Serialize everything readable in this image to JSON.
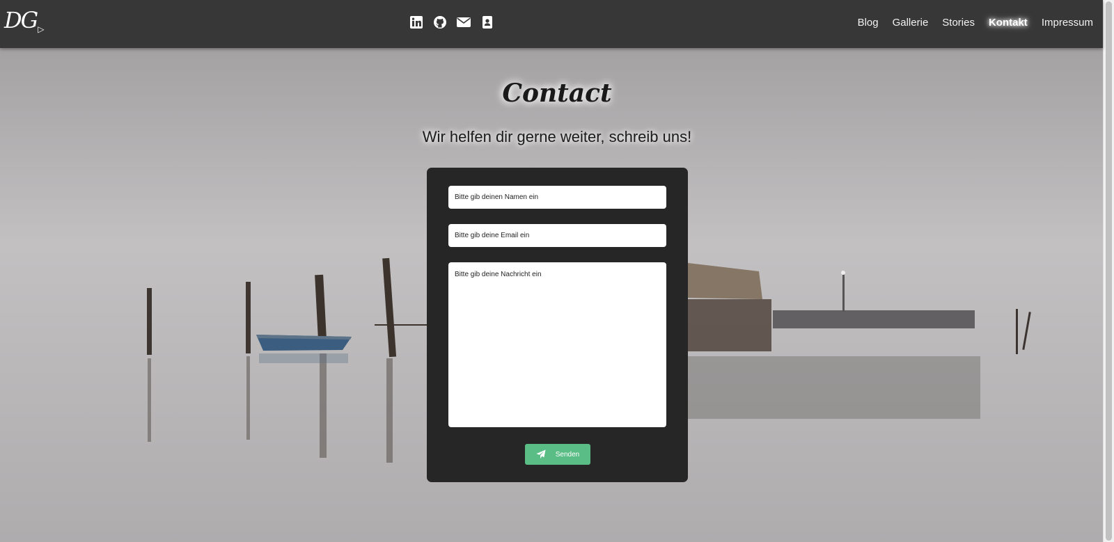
{
  "header": {
    "logo_text": "DG",
    "social_icons": [
      "linkedin-icon",
      "github-icon",
      "envelope-icon",
      "contact-card-icon"
    ],
    "nav": [
      {
        "label": "Blog",
        "active": false
      },
      {
        "label": "Gallerie",
        "active": false
      },
      {
        "label": "Stories",
        "active": false
      },
      {
        "label": "Kontakt",
        "active": true
      },
      {
        "label": "Impressum",
        "active": false
      }
    ]
  },
  "main": {
    "title": "Contact",
    "subtitle": "Wir helfen dir gerne weiter, schreib uns!"
  },
  "form": {
    "name_placeholder": "Bitte gib deinen Namen ein",
    "email_placeholder": "Bitte gib deine Email ein",
    "message_placeholder": "Bitte gib deine Nachricht ein",
    "submit_label": "Senden",
    "submit_icon": "paper-plane-icon"
  },
  "colors": {
    "header_bg": "#373737",
    "card_bg": "#262626",
    "button_bg": "#5bbd86"
  }
}
